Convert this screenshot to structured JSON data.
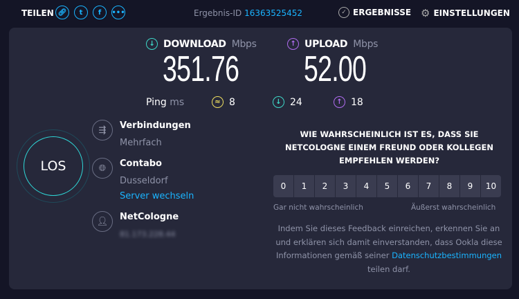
{
  "header": {
    "share_label": "TEILEN",
    "result_id_label": "Ergebnis-ID",
    "result_id": "16363525452",
    "results_label": "ERGEBNISSE",
    "settings_label": "EINSTELLUNGEN"
  },
  "speed": {
    "download_label": "DOWNLOAD",
    "upload_label": "UPLOAD",
    "unit": "Mbps",
    "download": "351.76",
    "upload": "52.00"
  },
  "ping": {
    "label": "Ping",
    "unit": "ms",
    "idle": "8",
    "download": "24",
    "upload": "18"
  },
  "go_label": "LOS",
  "connections": {
    "title": "Verbindungen",
    "value": "Mehrfach"
  },
  "server": {
    "name": "Contabo",
    "location": "Dusseldorf",
    "change_link": "Server wechseln"
  },
  "provider": {
    "name": "NetCologne",
    "ip": "81.173.228.44"
  },
  "survey": {
    "question": "WIE WAHRSCHEINLICH IST ES, DASS SIE NETCOLOGNE EINEM FREUND ODER KOLLEGEN EMPFEHLEN WERDEN?",
    "scale": [
      "0",
      "1",
      "2",
      "3",
      "4",
      "5",
      "6",
      "7",
      "8",
      "9",
      "10"
    ],
    "low_label": "Gar nicht wahrscheinlich",
    "high_label": "Äußerst wahrscheinlich",
    "disclaimer_pre": "Indem Sie dieses Feedback einreichen, erkennen Sie an und erklären sich damit einverstanden, dass Ookla diese Informationen gemäß seiner",
    "privacy_link": "Datenschutzbestimmungen",
    "disclaimer_post": "teilen darf."
  },
  "colors": {
    "accent": "#1ab4ff",
    "download": "#3ed8c8",
    "upload": "#b06cf0",
    "ping": "#f0e060"
  }
}
